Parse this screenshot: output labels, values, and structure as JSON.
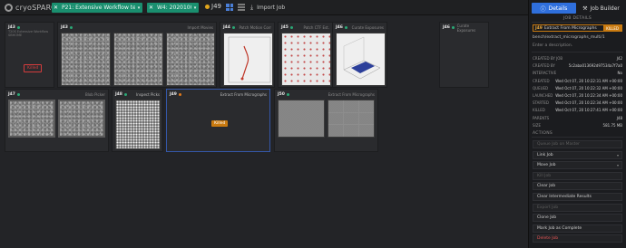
{
  "app": {
    "name": "cryoSPARC"
  },
  "topbar": {
    "project_label": "P21: Extensive Workflow testing",
    "workspace_label": "W4: 20201006",
    "current_job": "J49",
    "import_label": "Import Job",
    "close_glyph": "✕",
    "caret_glyph": "▾",
    "import_glyph": "⤓"
  },
  "cards": [
    {
      "id": "J43",
      "type": "",
      "subtitle": "T20S Extensive Workflow\nSBHOME",
      "badge": "Killed",
      "status_color": "#2aa876"
    },
    {
      "id": "J43",
      "type": "Import Movies",
      "subtitle": "",
      "badge": "",
      "status_color": "#2aa876"
    },
    {
      "id": "J44",
      "type": "Patch Motion Corr",
      "subtitle": "",
      "badge": "",
      "status_color": "#2aa876"
    },
    {
      "id": "J45",
      "type": "Patch CTF Est.",
      "subtitle": "",
      "badge": "",
      "status_color": "#2aa876"
    },
    {
      "id": "J46",
      "type": "Curate Exposures",
      "subtitle": "",
      "badge": "",
      "status_color": "#2aa876"
    },
    {
      "id": "J47",
      "type": "Blob Picker",
      "subtitle": "",
      "badge": "",
      "status_color": "#2aa876"
    },
    {
      "id": "J48",
      "type": "Inspect Picks",
      "subtitle": "",
      "badge": "",
      "status_color": "#2aa876"
    },
    {
      "id": "J49",
      "type": "Extract From Micrographs",
      "subtitle": "",
      "badge": "Killed",
      "status_color": "#e07a1c"
    },
    {
      "id": "J50",
      "type": "Extract From Micrographs",
      "subtitle": "",
      "badge": "",
      "status_color": "#2aa876"
    }
  ],
  "sidebar": {
    "tabs": [
      {
        "label": "Details",
        "icon": "ⓘ",
        "active": true
      },
      {
        "label": "Job Builder",
        "icon": "⚒",
        "active": false
      }
    ],
    "section_job_details": "JOB DETAILS",
    "job": {
      "id": "J49",
      "type": "Extract From Micrographs",
      "status": "KILLED"
    },
    "path": "bench/extract_micrographs_multi/1",
    "description_placeholder": "Enter a description.",
    "fields": [
      {
        "k": "CREATED BY JOB",
        "v": "J42"
      },
      {
        "k": "CREATED BY",
        "v": "5c2aba013692d97534a7f7a0"
      },
      {
        "k": "INTERACTIVE",
        "v": "No"
      },
      {
        "k": "CREATED",
        "v": "Wed Oct 07, 20 10:22:31 AM +00:00"
      },
      {
        "k": "QUEUED",
        "v": "Wed Oct 07, 20 10:22:32 AM +00:00"
      },
      {
        "k": "LAUNCHED",
        "v": "Wed Oct 07, 20 10:22:34 AM +00:00"
      },
      {
        "k": "STARTED",
        "v": "Wed Oct 07, 20 10:22:34 AM +00:00"
      },
      {
        "k": "KILLED",
        "v": "Wed Oct 07, 20 10:27:41 AM +00:00"
      },
      {
        "k": "PARENTS",
        "v": "J48"
      },
      {
        "k": "SIZE",
        "v": "581.75 MB"
      }
    ],
    "section_actions": "ACTIONS",
    "actions": [
      {
        "label": "Queue Job on Master",
        "state": "disabled"
      },
      {
        "label": "Link Job",
        "state": "dropdown"
      },
      {
        "label": "Move Job",
        "state": "dropdown"
      },
      {
        "label": "Kill Job",
        "state": "disabled"
      },
      {
        "label": "Clear Job",
        "state": "normal"
      },
      {
        "label": "Clear Intermediate Results",
        "state": "normal"
      },
      {
        "label": "Export Job",
        "state": "disabled"
      },
      {
        "label": "Clone Job",
        "state": "normal"
      },
      {
        "label": "Mark Job as Complete",
        "state": "normal"
      },
      {
        "label": "Delete Job",
        "state": "danger"
      }
    ],
    "caret_glyph": "▾"
  },
  "colors": {
    "accent": "#2f6fdc",
    "project_green": "#1a8f6f",
    "killed_orange": "#c97a10",
    "danger": "#e05454"
  }
}
